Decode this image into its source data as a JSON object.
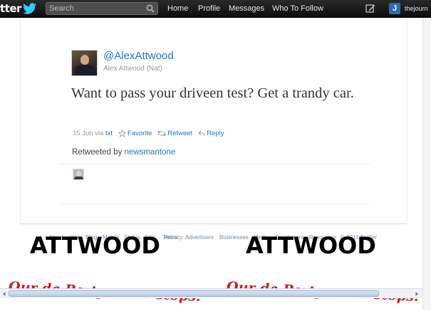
{
  "topbar": {
    "logo_text": "tter",
    "search": {
      "placeholder": "Search",
      "value": ""
    },
    "nav": [
      "Home",
      "Profile",
      "Messages",
      "Who To Follow"
    ],
    "user": {
      "initial": "J",
      "name": "thejourn"
    }
  },
  "tweet": {
    "screen_name": "@AlexAttwood",
    "full_name": "Alex Attwood (Nat)",
    "text": "Want to pass your driveen test? Get a trandy car.",
    "date": "15 Jun",
    "via_prefix": "via",
    "via_source": "txt",
    "actions": {
      "favorite": "Favorite",
      "retweet": "Retweet",
      "reply": "Reply"
    },
    "retweeted_prefix": "Retweeted by",
    "retweeted_by": "newsmantone"
  },
  "footer": {
    "links": [
      "About",
      "Help",
      "Blog",
      "Mobile",
      "Status",
      "Jobs",
      "Terms",
      "Privacy",
      "Advertisers",
      "Businesses",
      "Media",
      "Developers",
      "Resources"
    ],
    "copyright": "© 2011 Twitter"
  },
  "overlay": {
    "stamp_left": "ATTWOOD",
    "stamp_right": "ATTWOOD",
    "slogan_left": "Our da Party never stops!",
    "slogan_right": "Our da Party never stops!"
  },
  "colors": {
    "topbar": "#1a1a1a",
    "link": "#2276bb",
    "slogan": "#c81e1e",
    "logo_bird": "#33ccff"
  }
}
